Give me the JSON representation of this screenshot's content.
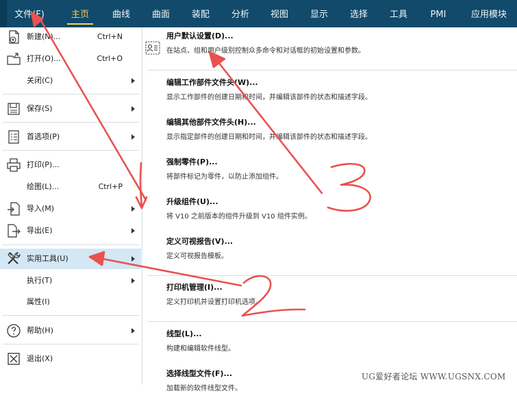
{
  "ribbon": {
    "tabs": [
      {
        "label": "文件(F)"
      },
      {
        "label": "主页"
      },
      {
        "label": "曲线"
      },
      {
        "label": "曲面"
      },
      {
        "label": "装配"
      },
      {
        "label": "分析"
      },
      {
        "label": "视图"
      },
      {
        "label": "显示"
      },
      {
        "label": "选择"
      },
      {
        "label": "工具"
      },
      {
        "label": "PMI"
      },
      {
        "label": "应用模块"
      }
    ],
    "active_tab": "主页",
    "colors": {
      "background": "#114a6b",
      "active": "#ffd24a",
      "text": "#f1f5f8"
    }
  },
  "file_menu": {
    "items": [
      {
        "label": "新建(N)...",
        "shortcut": "Ctrl+N",
        "icon": "new-file-icon",
        "has_submenu": false
      },
      {
        "label": "打开(O)...",
        "shortcut": "Ctrl+O",
        "icon": "open-folder-icon",
        "has_submenu": false
      },
      {
        "label": "关闭(C)",
        "shortcut": "",
        "icon": "",
        "has_submenu": true
      },
      {
        "label": "保存(S)",
        "shortcut": "",
        "icon": "save-icon",
        "has_submenu": true
      },
      {
        "label": "首选项(P)",
        "shortcut": "",
        "icon": "preferences-icon",
        "has_submenu": true
      },
      {
        "label": "打印(P)...",
        "shortcut": "",
        "icon": "printer-icon",
        "has_submenu": false
      },
      {
        "label": "绘图(L)...",
        "shortcut": "Ctrl+P",
        "icon": "",
        "has_submenu": false
      },
      {
        "label": "导入(M)",
        "shortcut": "",
        "icon": "import-icon",
        "has_submenu": true
      },
      {
        "label": "导出(E)",
        "shortcut": "",
        "icon": "export-icon",
        "has_submenu": true
      },
      {
        "label": "实用工具(U)",
        "shortcut": "",
        "icon": "tools-icon",
        "has_submenu": true,
        "highlighted": true
      },
      {
        "label": "执行(T)",
        "shortcut": "",
        "icon": "",
        "has_submenu": true
      },
      {
        "label": "属性(I)",
        "shortcut": "",
        "icon": "",
        "has_submenu": false
      },
      {
        "label": "帮助(H)",
        "shortcut": "",
        "icon": "help-icon",
        "has_submenu": true
      },
      {
        "label": "退出(X)",
        "shortcut": "",
        "icon": "exit-icon",
        "has_submenu": false
      }
    ]
  },
  "utilities_submenu": {
    "items": [
      {
        "title": "用户默认设置(D)...",
        "description": "在站点、组和用户级别控制众多命令和对话框的初始设置和参数。",
        "icon": "user-defaults-icon"
      },
      {
        "title": "编辑工作部件文件头(W)...",
        "description": "显示工作部件的创建日期和时间，并编辑该部件的状态和描述字段。"
      },
      {
        "title": "编辑其他部件文件头(H)...",
        "description": "显示指定部件的创建日期和时间，并编辑该部件的状态和描述字段。"
      },
      {
        "title": "强制零件(P)...",
        "description": "将部件标记为零件，以防止添加组件。"
      },
      {
        "title": "升级组件(U)...",
        "description": "将 V10 之前版本的组件升级到 V10 组件实例。"
      },
      {
        "title": "定义可视报告(V)...",
        "description": "定义可视报告模板。"
      },
      {
        "title": "打印机管理(I)...",
        "description": "定义打印机并设置打印机选项。"
      },
      {
        "title": "线型(L)...",
        "description": "构建和编辑软件线型。"
      },
      {
        "title": "选择线型文件(F)...",
        "description": "加载新的软件线型文件。"
      }
    ]
  },
  "annotations": {
    "handwritten_numbers": [
      "1",
      "2",
      "3"
    ],
    "arrow_color": "#e8524f"
  },
  "watermark": "UG爱好者论坛 WWW.UGSNX.COM"
}
